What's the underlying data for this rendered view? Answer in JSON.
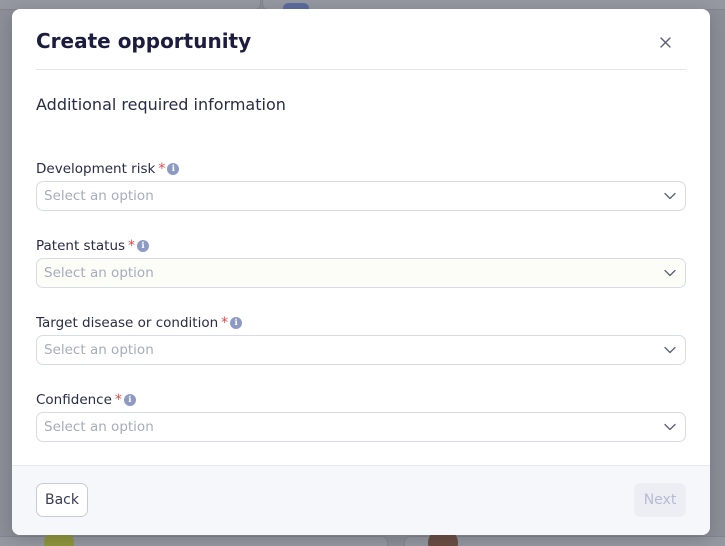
{
  "modal": {
    "title": "Create opportunity",
    "close_icon": "close-icon",
    "section_title": "Additional required information"
  },
  "fields": [
    {
      "label": "Development risk",
      "required_mark": "*",
      "info_icon": "info-icon",
      "info_glyph": "i",
      "placeholder": "Select an option"
    },
    {
      "label": "Patent status",
      "required_mark": "*",
      "info_icon": "info-icon",
      "info_glyph": "i",
      "placeholder": "Select an option"
    },
    {
      "label": "Target disease or condition",
      "required_mark": "*",
      "info_icon": "info-icon",
      "info_glyph": "i",
      "placeholder": "Select an option"
    },
    {
      "label": "Confidence",
      "required_mark": "*",
      "info_icon": "info-icon",
      "info_glyph": "i",
      "placeholder": "Select an option"
    }
  ],
  "footer": {
    "back_label": "Back",
    "next_label": "Next"
  },
  "colors": {
    "title": "#1c1d3e",
    "required": "#e5484d",
    "info": "#8d9bc4",
    "placeholder": "#a7abbd",
    "next_disabled_text": "#b6bbd2",
    "footer_bg": "#f6f7fa"
  }
}
